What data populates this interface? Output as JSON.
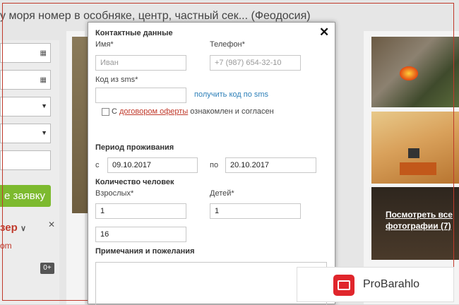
{
  "background": {
    "title": "у моря номер в особняке, центр, частный сек... (Феодосия)",
    "submit_button": "е заявку",
    "partner_link": "зер",
    "partner_small": "om",
    "badge": "0+",
    "photos_link_line1": "Посмотреть все",
    "photos_link_line2": "фотографии (7)"
  },
  "modal": {
    "contacts_header": "Контактные данные",
    "name_label": "Имя*",
    "name_placeholder": "Иван",
    "phone_label": "Телефон*",
    "phone_placeholder": "+7 (987) 654-32-10",
    "sms_label": "Код из sms*",
    "sms_value": "",
    "sms_link": "получить код по sms",
    "offer_prefix": "С ",
    "offer_link": "договором оферты",
    "offer_suffix": " ознакомлен и согласен",
    "period_header": "Период проживания",
    "from_label": "с",
    "from_value": "09.10.2017",
    "to_label": "по",
    "to_value": "20.10.2017",
    "guests_header": "Количество человек",
    "adults_label": "Взрослых*",
    "adults_value": "1",
    "children_label": "Детей*",
    "children_value": "1",
    "age_value": "16",
    "notes_header": "Примечания и пожелания"
  },
  "watermark": {
    "text": "ProBarahlo"
  }
}
